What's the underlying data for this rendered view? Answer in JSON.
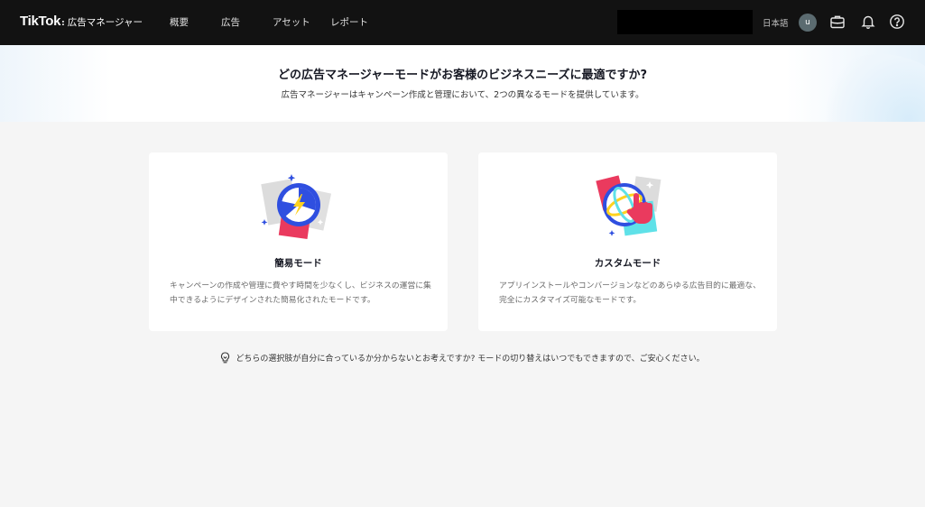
{
  "header": {
    "logo_main": "TikTok",
    "logo_colon": ":",
    "logo_sub": "広告マネージャー",
    "nav": [
      {
        "label": "概要"
      },
      {
        "label": "広告"
      },
      {
        "label": "アセット"
      },
      {
        "label": "レポート"
      }
    ],
    "language": "日本語",
    "avatar_initial": "u",
    "icons": [
      "briefcase-icon",
      "bell-icon",
      "help-icon"
    ]
  },
  "hero": {
    "title": "どの広告マネージャーモードがお客様のビジネスニーズに最適ですか?",
    "subtitle": "広告マネージャーはキャンペーン作成と管理において、2つの異なるモードを提供しています。"
  },
  "cards": [
    {
      "title": "簡易モード",
      "description": "キャンペーンの作成や管理に費やす時間を少なくし、ビジネスの運営に集中できるようにデザインされた簡易化されたモードです。",
      "icon": "stopwatch-lightning-icon"
    },
    {
      "title": "カスタムモード",
      "description": "アプリインストールやコンバージョンなどのあらゆる広告目的に最適な、完全にカスタマイズ可能なモードです。",
      "icon": "globe-pointer-icon"
    }
  ],
  "hint": {
    "text": "どちらの選択肢が自分に合っているか分からないとお考えですか?  モードの切り替えはいつでもできますので、ご安心ください。",
    "icon": "lightbulb-icon"
  },
  "colors": {
    "topbar": "#121212",
    "accent_red": "#ea3a5e",
    "accent_blue": "#2f4fe0",
    "accent_cyan": "#5fe1e8",
    "accent_yellow": "#ffd21f"
  }
}
